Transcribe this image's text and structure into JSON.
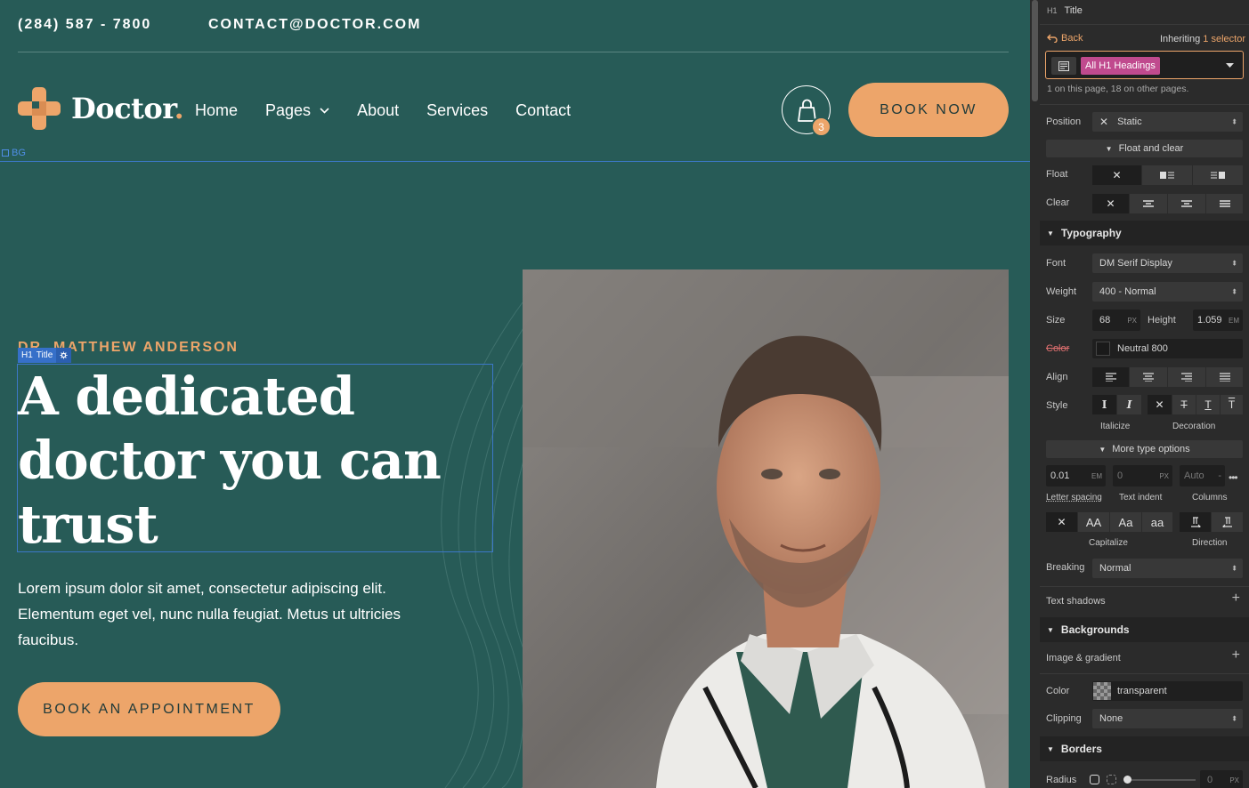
{
  "site": {
    "phone": "(284) 587 - 7800",
    "email": "CONTACT@DOCTOR.COM",
    "brand": "Doctor",
    "brand_dot": ".",
    "nav": [
      "Home",
      "Pages",
      "About",
      "Services",
      "Contact"
    ],
    "cart_count": "3",
    "book_now": "BOOK NOW",
    "bg_label": "BG",
    "eyebrow": "DR. MATTHEW ANDERSON",
    "selection_tag": "Title",
    "selection_tag_prefix": "H1",
    "headline": "A dedicated doctor you can trust",
    "lorem": "Lorem ipsum dolor sit amet, consectetur adipiscing elit. Elementum eget vel, nunc nulla feugiat. Metus ut ultricies faucibus.",
    "appointment": "BOOK AN APPOINTMENT",
    "colors": {
      "accent": "#eda56a",
      "bg": "#275b57",
      "selection": "#3c78c8"
    }
  },
  "panel": {
    "element_prefix": "H1",
    "element_name": "Title",
    "back": "Back",
    "inheriting_label": "Inheriting",
    "inheriting_count": "1 selector",
    "selector_chip": "All H1 Headings",
    "usage_note": "1 on this page, 18 on other pages.",
    "position_label": "Position",
    "position_value": "Static",
    "float_clear_toggle": "Float and clear",
    "float_label": "Float",
    "clear_label": "Clear",
    "typography": {
      "title": "Typography",
      "font_label": "Font",
      "font_value": "DM Serif Display",
      "weight_label": "Weight",
      "weight_value": "400 - Normal",
      "size_label": "Size",
      "size_value": "68",
      "size_unit": "PX",
      "height_label": "Height",
      "height_value": "1.059",
      "height_unit": "EM",
      "color_label": "Color",
      "color_value": "Neutral 800",
      "align_label": "Align",
      "style_label": "Style",
      "italicize_label": "Italicize",
      "decoration_label": "Decoration",
      "more_options": "More type options",
      "letter_spacing_value": "0.01",
      "letter_spacing_unit": "EM",
      "text_indent_value": "0",
      "text_indent_unit": "PX",
      "columns_value": "Auto",
      "columns_dash": "-",
      "letter_spacing_label": "Letter spacing",
      "text_indent_label": "Text indent",
      "columns_label": "Columns",
      "capitalize_label": "Capitalize",
      "direction_label": "Direction",
      "breaking_label": "Breaking",
      "breaking_value": "Normal",
      "shadows_label": "Text shadows"
    },
    "backgrounds": {
      "title": "Backgrounds",
      "image_label": "Image & gradient",
      "color_label": "Color",
      "color_value": "transparent",
      "clipping_label": "Clipping",
      "clipping_value": "None"
    },
    "borders": {
      "title": "Borders",
      "radius_label": "Radius",
      "radius_value": "0",
      "radius_unit": "PX"
    }
  }
}
